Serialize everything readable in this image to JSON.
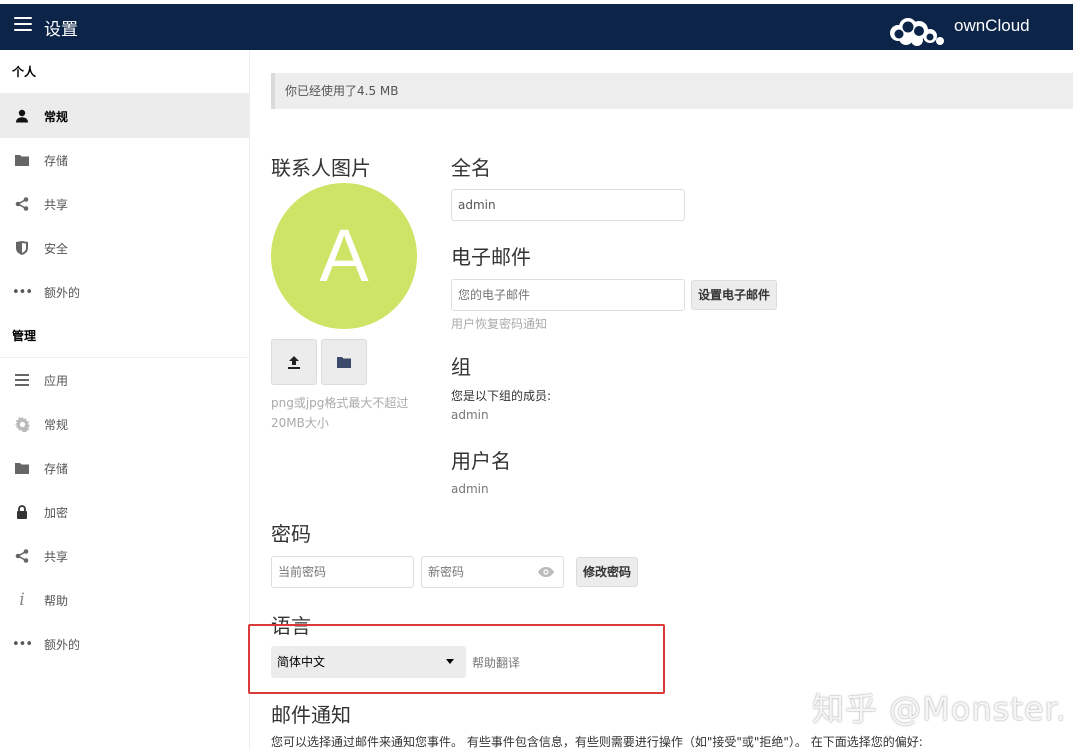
{
  "header": {
    "title": "设置",
    "brand": "ownCloud"
  },
  "sidebar": {
    "personal_section": "个人",
    "personal_items": [
      {
        "label": "常规",
        "icon": "user-icon",
        "active": true
      },
      {
        "label": "存储",
        "icon": "folder-icon"
      },
      {
        "label": "共享",
        "icon": "share-icon"
      },
      {
        "label": "安全",
        "icon": "shield-icon"
      },
      {
        "label": "额外的",
        "icon": "more-icon"
      }
    ],
    "admin_section": "管理",
    "admin_items": [
      {
        "label": "应用",
        "icon": "list-icon"
      },
      {
        "label": "常规",
        "icon": "gear-icon"
      },
      {
        "label": "存储",
        "icon": "folder-icon"
      },
      {
        "label": "加密",
        "icon": "lock-icon"
      },
      {
        "label": "共享",
        "icon": "share-icon"
      },
      {
        "label": "帮助",
        "icon": "info-icon"
      },
      {
        "label": "额外的",
        "icon": "more-icon"
      }
    ]
  },
  "quota": {
    "text": "你已经使用了",
    "amount": "4.5 MB"
  },
  "avatar": {
    "heading": "联系人图片",
    "letter": "A",
    "color": "#cde466",
    "hint": "png或jpg格式最大不超过20MB大小"
  },
  "fullname": {
    "heading": "全名",
    "value": "admin"
  },
  "email": {
    "heading": "电子邮件",
    "placeholder": "您的电子邮件",
    "button": "设置电子邮件",
    "hint": "用户恢复密码通知"
  },
  "groups": {
    "heading": "组",
    "label": "您是以下组的成员:",
    "value": "admin"
  },
  "username": {
    "heading": "用户名",
    "value": "admin"
  },
  "password": {
    "heading": "密码",
    "current_placeholder": "当前密码",
    "new_placeholder": "新密码",
    "button": "修改密码"
  },
  "language": {
    "heading": "语言",
    "selected": "简体中文",
    "help_link": "帮助翻译"
  },
  "notifications": {
    "heading": "邮件通知",
    "description": "您可以选择通过邮件来通知您事件。 有些事件包含信息，有些则需要进行操作（如\"接受\"或\"拒绝\"）。 在下面选择您的偏好:"
  },
  "watermark": "知乎 @Monster.",
  "colors": {
    "topbar": "#0b2448",
    "highlight": "#d93a3a"
  }
}
